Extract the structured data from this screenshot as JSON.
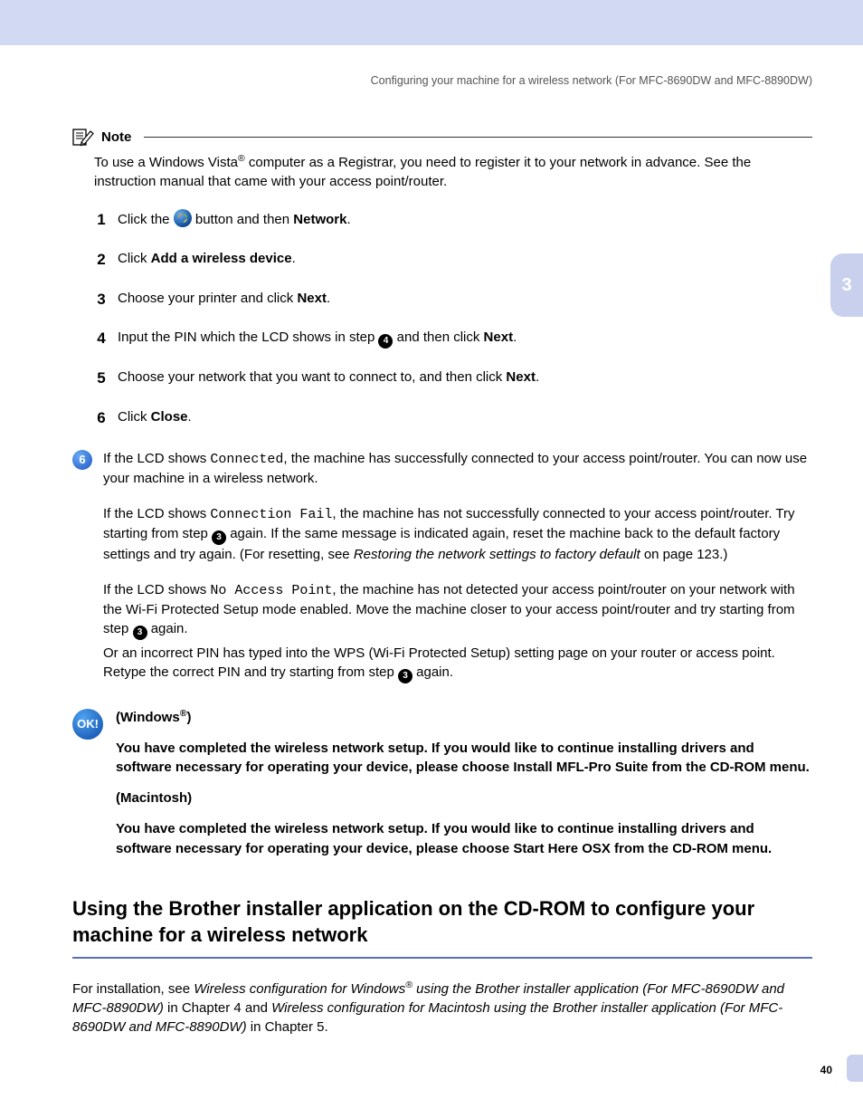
{
  "header": {
    "running": "Configuring your machine for a wireless network (For MFC-8690DW and MFC-8890DW)",
    "chapter": "3"
  },
  "note": {
    "label": "Note",
    "body_pre": "To use a Windows Vista",
    "body_post": " computer as a Registrar, you need to register it to your network in advance. See the instruction manual that came with your access point/router."
  },
  "sub_steps": {
    "s1": {
      "num": "1",
      "pre": "Click the ",
      "mid": " button and then ",
      "bold": "Network",
      "post": "."
    },
    "s2": {
      "num": "2",
      "pre": "Click ",
      "bold": "Add a wireless device",
      "post": "."
    },
    "s3": {
      "num": "3",
      "pre": "Choose your printer and click ",
      "bold": "Next",
      "post": "."
    },
    "s4": {
      "num": "4",
      "pre": "Input the PIN which the LCD shows in step ",
      "bullet": "4",
      "mid": " and then click ",
      "bold": "Next",
      "post": "."
    },
    "s5": {
      "num": "5",
      "pre": "Choose your network that you want to connect to, and then click ",
      "bold": "Next",
      "post": "."
    },
    "s6": {
      "num": "6",
      "pre": "Click ",
      "bold": "Close",
      "post": "."
    }
  },
  "main6": {
    "bullet": "6",
    "p1_pre": "If the LCD shows ",
    "p1_code": "Connected",
    "p1_post": ", the machine has successfully connected to your access point/router. You can now use your machine in a wireless network.",
    "p2_pre": "If the LCD shows ",
    "p2_code": "Connection Fail",
    "p2_mid": ", the machine has not successfully connected to your access point/router. Try starting from step ",
    "p2_b": "3",
    "p2_mid2": " again. If the same message is indicated again, reset the machine back to the default factory settings and try again. (For resetting, see ",
    "p2_i": "Restoring the network settings to factory default",
    "p2_post": " on page 123.)",
    "p3_pre": "If the LCD shows ",
    "p3_code": "No Access Point",
    "p3_mid": ", the machine has not detected your access point/router on your network with the Wi-Fi Protected Setup mode enabled. Move the machine closer to your access point/router and try starting from step ",
    "p3_b": "3",
    "p3_post": " again.",
    "p4_pre": "Or an incorrect PIN has typed into the WPS (Wi-Fi Protected Setup) setting page on your router or access point. Retype the correct PIN and try starting from step ",
    "p4_b": "3",
    "p4_post": " again."
  },
  "ok": {
    "badge": "OK!",
    "win_label_pre": "(Windows",
    "win_label_post": ")",
    "win_text": "You have completed the wireless network setup. If you would like to continue installing drivers and software necessary for operating your device, please choose Install MFL-Pro Suite from the CD-ROM menu.",
    "mac_label": "(Macintosh)",
    "mac_text": "You have completed the wireless network setup. If you would like to continue installing drivers and software necessary for operating your device, please choose Start Here OSX from the CD-ROM menu."
  },
  "section": {
    "heading": "Using the Brother installer application on the CD-ROM to configure your machine for a wireless network",
    "body_pre": "For installation, see ",
    "body_i1a": "Wireless configuration for Windows",
    "body_i1b": " using the Brother installer application (For MFC-8690DW and MFC-8890DW)",
    "body_mid": " in Chapter 4 and ",
    "body_i2": "Wireless configuration for Macintosh using the Brother installer application (For MFC-8690DW and MFC-8890DW)",
    "body_post": " in Chapter 5."
  },
  "footer": {
    "page": "40"
  }
}
